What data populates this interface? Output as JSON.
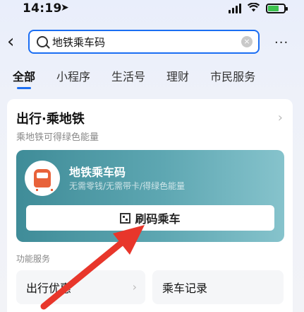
{
  "status_bar": {
    "time": "14:19",
    "location_glyph": "➤"
  },
  "header": {
    "back_glyph": "‹",
    "search_value": "地铁乘车码",
    "clear_glyph": "×",
    "more_glyph": "···"
  },
  "tabs": [
    {
      "label": "全部",
      "active": true
    },
    {
      "label": "小程序"
    },
    {
      "label": "生活号"
    },
    {
      "label": "理财"
    },
    {
      "label": "市民服务"
    }
  ],
  "card": {
    "title": "出行·乘地铁",
    "subtitle": "乘地铁可得绿色能量",
    "chevron_glyph": "›",
    "metro": {
      "name": "地铁乘车码",
      "description": "无需零钱/无需带卡/得绿色能量",
      "button_label": "刷码乘车"
    },
    "section_label": "功能服务",
    "services": [
      {
        "label": "出行优惠"
      },
      {
        "label": "乘车记录"
      }
    ]
  },
  "colors": {
    "accent": "#1b6ef3",
    "metro_panel": "#4f9aa5",
    "annotation_arrow": "#e8362b"
  }
}
